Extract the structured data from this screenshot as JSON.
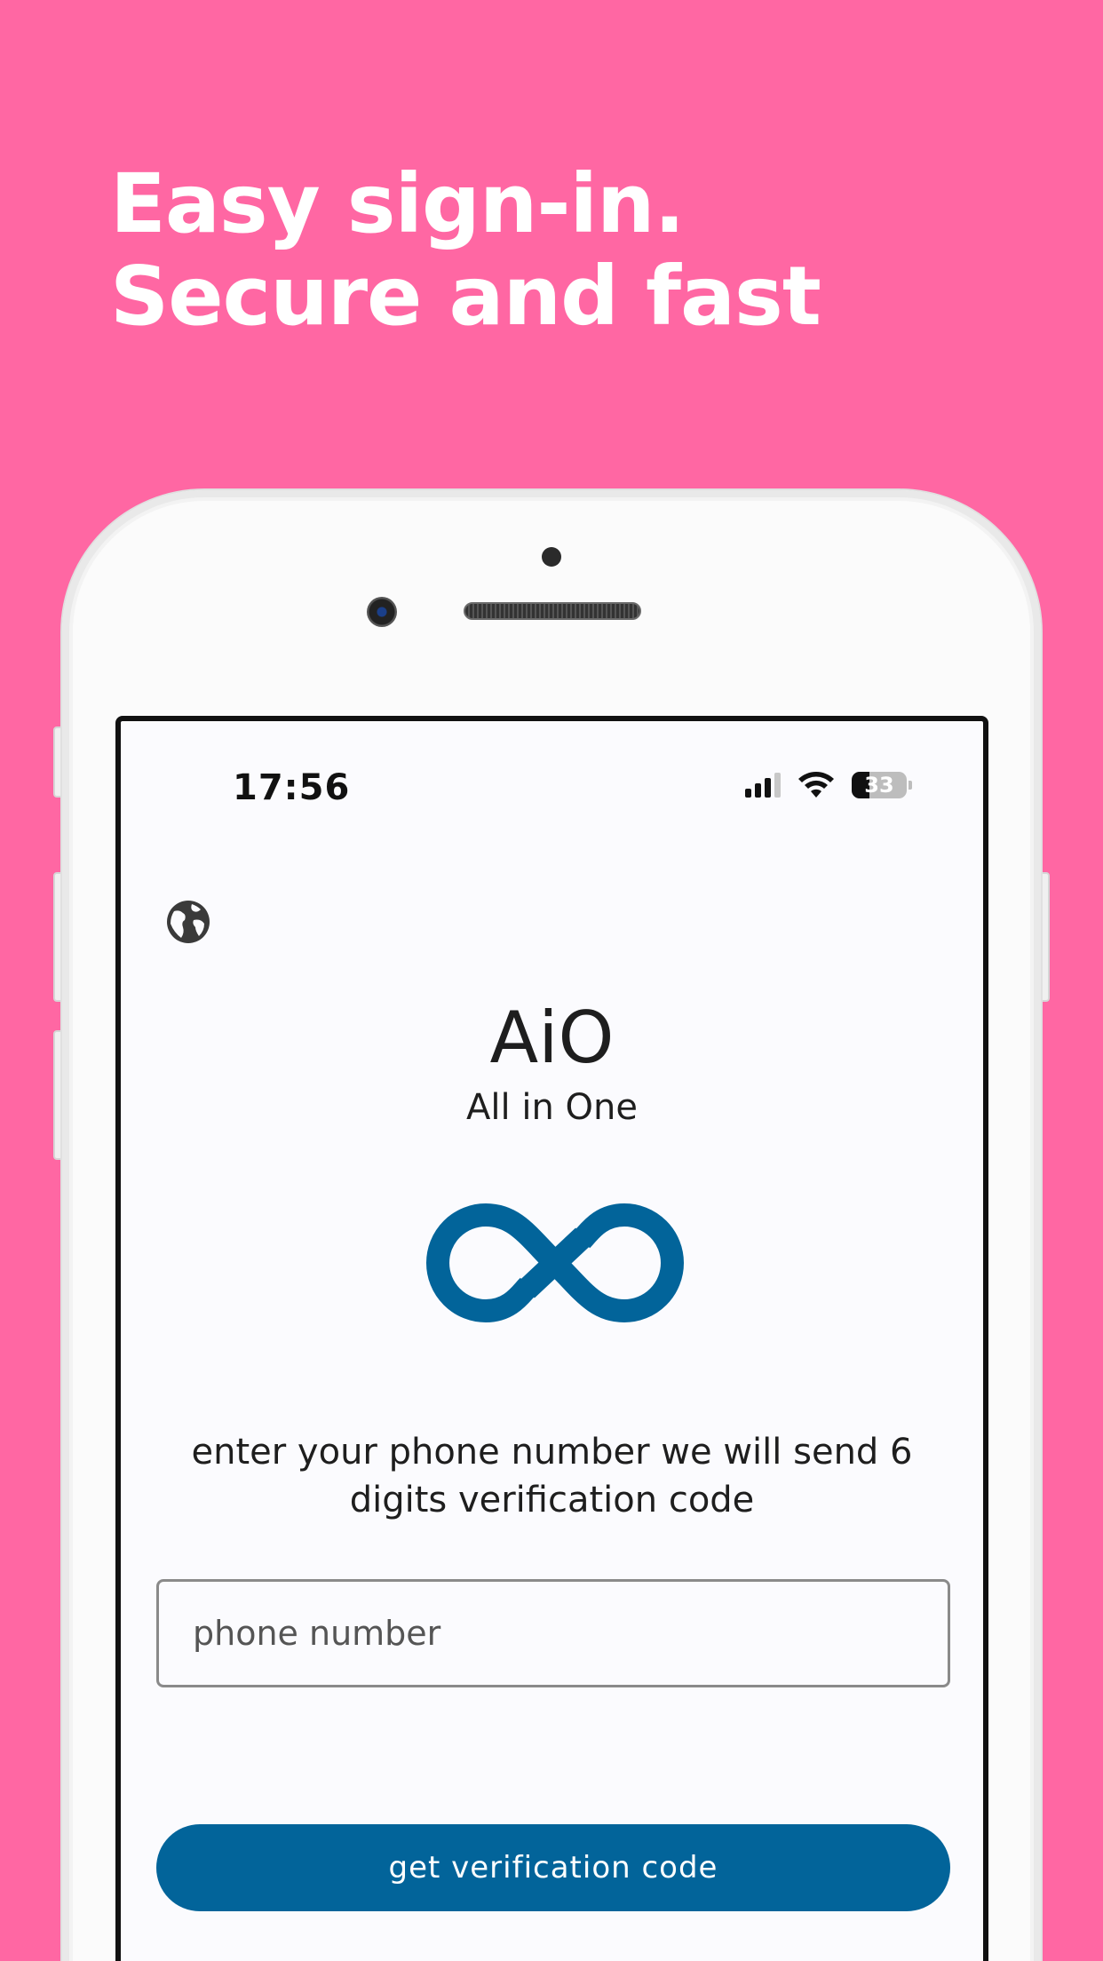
{
  "headline": "Easy sign-in. Secure and fast",
  "colors": {
    "background": "#ff67a3",
    "accent": "#02649a"
  },
  "status_bar": {
    "time": "17:56",
    "battery": "33",
    "battery_level": 0.33,
    "signal_bars": 3,
    "icons": [
      "cellular-signal-icon",
      "wifi-icon",
      "battery-icon"
    ]
  },
  "app": {
    "title": "AiO",
    "subtitle": "All in One",
    "logo_icon": "infinity-logo-icon",
    "language_icon": "globe-icon"
  },
  "form": {
    "instructions": "enter your phone number we will send 6 digits verification code",
    "phone_placeholder": "phone number",
    "phone_value": "",
    "submit_label": "get verification code"
  }
}
